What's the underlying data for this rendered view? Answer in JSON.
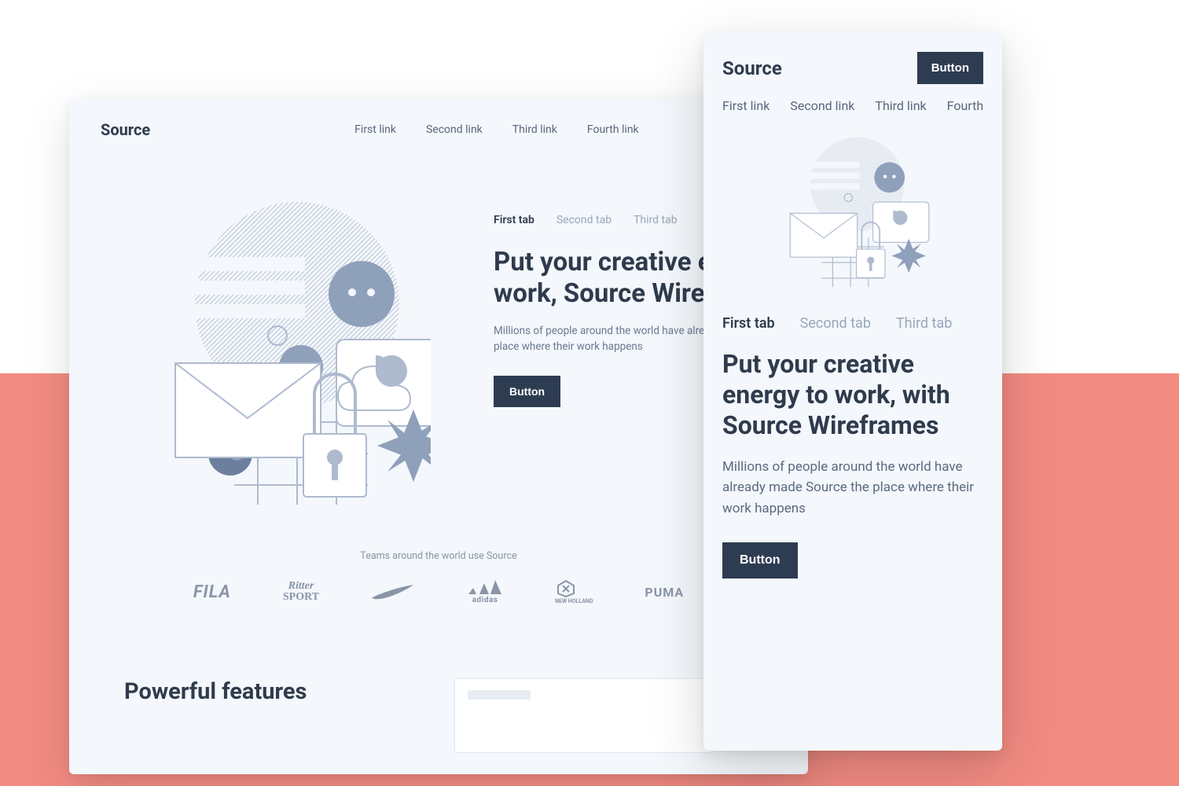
{
  "brand": "Source",
  "nav_links": [
    "First link",
    "Second link",
    "Third link",
    "Fourth link"
  ],
  "hero": {
    "tabs": [
      "First tab",
      "Second tab",
      "Third tab"
    ],
    "active_tab": 0,
    "headline_desktop": "Put your creative energy to work, Source Wireframes",
    "headline_mobile": "Put your creative energy to work, with Source Wireframes",
    "sub_desktop": "Millions of people around the world have already made Forma the place where their work happens",
    "sub_mobile": "Millions of people around the world have already made Source the place where their work happens",
    "cta_label": "Button"
  },
  "teams": {
    "caption": "Teams around the world use Source",
    "brands": [
      "FILA",
      "Ritter SPORT",
      "NIKE",
      "adidas",
      "NEW HOLLAND",
      "PUMA"
    ]
  },
  "features": {
    "title": "Powerful features"
  },
  "mobile_header_button": "Button",
  "colors": {
    "accent": "#2e3c52",
    "text": "#2f3b4d",
    "muted": "#8a95a8",
    "coral": "#f28b82",
    "bg": "#f4f7fb"
  }
}
